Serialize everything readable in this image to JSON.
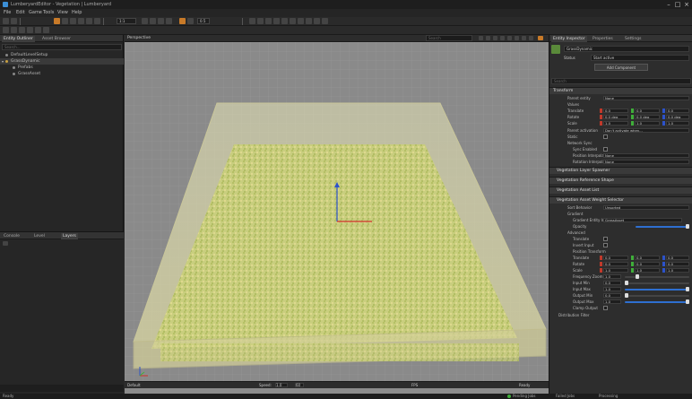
{
  "window": {
    "title": "LumberyardEditor - Vegetation | Lumberyard",
    "controls": [
      "–",
      "□",
      "×"
    ]
  },
  "menu": {
    "items": [
      "File",
      "Edit",
      "Game",
      "Tools",
      "View",
      "Help"
    ]
  },
  "toolbar": {
    "frame_label": "1:1",
    "snap_value": "0.5"
  },
  "left_panel": {
    "tabs": [
      "Entity Outliner",
      "Asset Browser"
    ],
    "search_placeholder": "Search...",
    "tree": [
      {
        "label": "DefaultLevelSetup",
        "indent": 1
      },
      {
        "label": "GrassDynamic",
        "indent": 1
      },
      {
        "label": "Prefabs",
        "indent": 2
      },
      {
        "label": "GrassAsset",
        "indent": 2
      }
    ]
  },
  "bottom_left": {
    "tabs": [
      "Console",
      "Level",
      "Layers"
    ]
  },
  "viewport": {
    "title": "Perspective",
    "search_placeholder": "Search",
    "footer": {
      "camera": "Default",
      "speed_label": "Speed:",
      "speed": "1.0",
      "fov": "60",
      "fps_label": "FPS",
      "status": "Ready"
    }
  },
  "inspector": {
    "tabs": [
      "Entity Inspector",
      "Properties",
      "Settings"
    ],
    "entity_name": "GrassDynamic",
    "status_label": "Status",
    "status_value": "Start active",
    "add_component": "Add Component",
    "search_placeholder": "Search",
    "transform": {
      "header": "Transform",
      "rows": [
        {
          "label": "Parent entity",
          "value": "None"
        },
        {
          "label": "Values",
          "value": ""
        },
        {
          "label": "Translate",
          "x": "0.0",
          "y": "0.0",
          "z": "0.0"
        },
        {
          "label": "Rotate",
          "x": "0.0 deg",
          "y": "0.0 deg",
          "z": "0.0 deg"
        },
        {
          "label": "Scale",
          "x": "1.0",
          "y": "1.0",
          "z": "1.0"
        },
        {
          "label": "Parent activation",
          "value": "Don't activate when..."
        },
        {
          "label": "Static",
          "value": ""
        },
        {
          "label": "Network Sync",
          "value": ""
        },
        {
          "label": "Sync Enabled",
          "value": ""
        },
        {
          "label": "Position Interpolation",
          "value": "None"
        },
        {
          "label": "Rotation Interpolation",
          "value": "None"
        }
      ]
    },
    "components": [
      "Vegetation Layer Spawner",
      "Vegetation Reference Shape",
      "Vegetation Asset List",
      "Vegetation Asset Weight Selector"
    ],
    "distribution": {
      "rows": [
        {
          "label": "Sort Behavior",
          "value": "Unsorted"
        },
        {
          "label": "Gradient",
          "value": ""
        },
        {
          "label": "Gradient Entity Id",
          "value": "GrassAsset"
        },
        {
          "label": "Opacity",
          "value": "1.0"
        },
        {
          "label": "Advanced",
          "value": ""
        },
        {
          "label": "Translate",
          "value": ""
        },
        {
          "label": "Invert Input",
          "value": ""
        },
        {
          "label": "Position Transform",
          "value": ""
        },
        {
          "label": "Translate",
          "x": "0.0",
          "y": "0.0",
          "z": "0.0"
        },
        {
          "label": "Rotate",
          "x": "0.0",
          "y": "0.0",
          "z": "0.0"
        },
        {
          "label": "Scale",
          "x": "1.0",
          "y": "1.0",
          "z": "1.0"
        },
        {
          "label": "Frequency Zoom",
          "value": "1.0"
        },
        {
          "label": "Input Min",
          "value": "0.0"
        },
        {
          "label": "Input Max",
          "value": "1.0"
        },
        {
          "label": "Output Min",
          "value": "0.0"
        },
        {
          "label": "Output Max",
          "value": "1.0"
        },
        {
          "label": "Clamp Output",
          "value": ""
        }
      ],
      "footer": "Distribution Filter"
    }
  },
  "statusbar": {
    "left": "Ready",
    "right_items": [
      "Pending Jobs",
      "Failed Jobs",
      "Processing"
    ]
  },
  "colors": {
    "accent_orange": "#c87a28",
    "accent_blue": "#2e6fd0",
    "grass_light": "#d8db8a",
    "grass_green": "#a9bb55",
    "volume_fill": "#e6e4b0"
  }
}
